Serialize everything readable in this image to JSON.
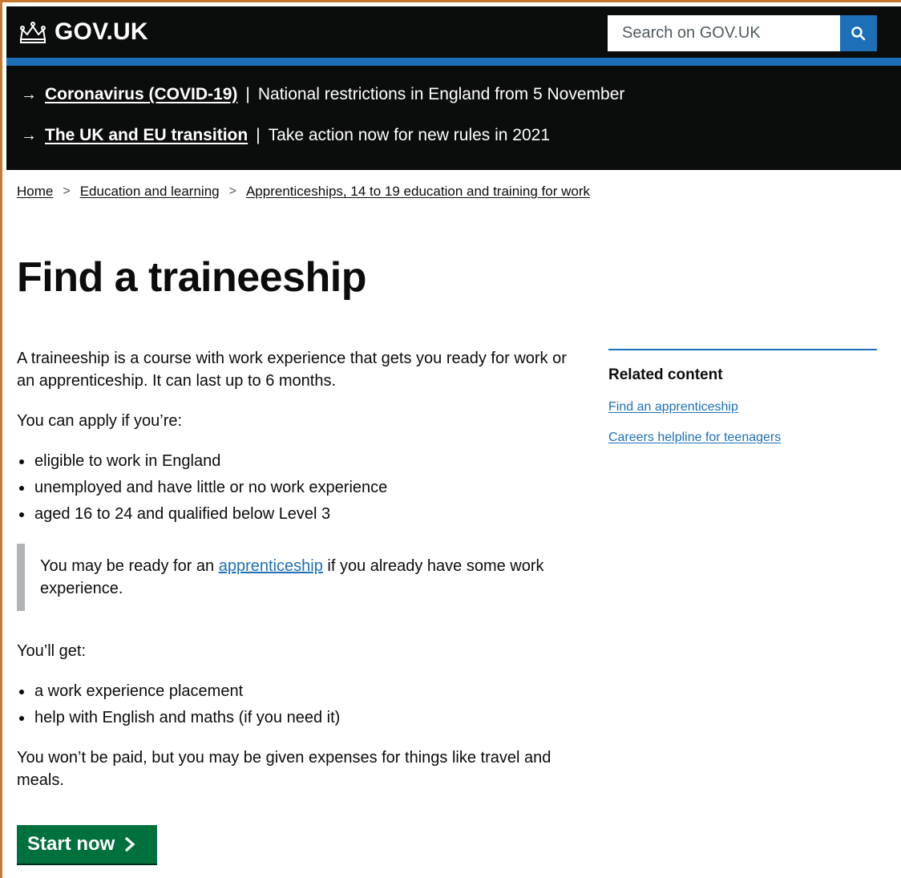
{
  "header": {
    "logo_text": "GOV.UK",
    "search_placeholder": "Search on GOV.UK"
  },
  "emergency": [
    {
      "link": "Coronavirus (COVID-19)",
      "text": "National restrictions in England from 5 November"
    },
    {
      "link": "The UK and EU transition",
      "text": "Take action now for new rules in 2021"
    }
  ],
  "breadcrumb": [
    "Home",
    "Education and learning",
    "Apprenticeships, 14 to 19 education and training for work"
  ],
  "page": {
    "title": "Find a traineeship",
    "intro": "A traineeship is a course with work experience that gets you ready for work or an apprenticeship. It can last up to 6 months.",
    "apply_lead": "You can apply if you’re:",
    "apply_items": [
      "eligible to work in England",
      "unemployed and have little or no work experience",
      "aged 16 to 24 and qualified below Level 3"
    ],
    "inset_before": "You may be ready for an ",
    "inset_link": "apprenticeship",
    "inset_after": " if you already have some work experience.",
    "get_lead": "You’ll get:",
    "get_items": [
      "a work experience placement",
      "help with English and maths (if you need it)"
    ],
    "paid_text": "You won’t be paid, but you may be given expenses for things like travel and meals.",
    "start_label": "Start now"
  },
  "related": {
    "heading": "Related content",
    "links": [
      "Find an apprenticeship",
      "Careers helpline for teenagers"
    ]
  },
  "colors": {
    "header_bg": "#0b0c0c",
    "brand_blue": "#1d70b8",
    "button_green": "#00703c",
    "inset_border": "#b1b4b6"
  }
}
